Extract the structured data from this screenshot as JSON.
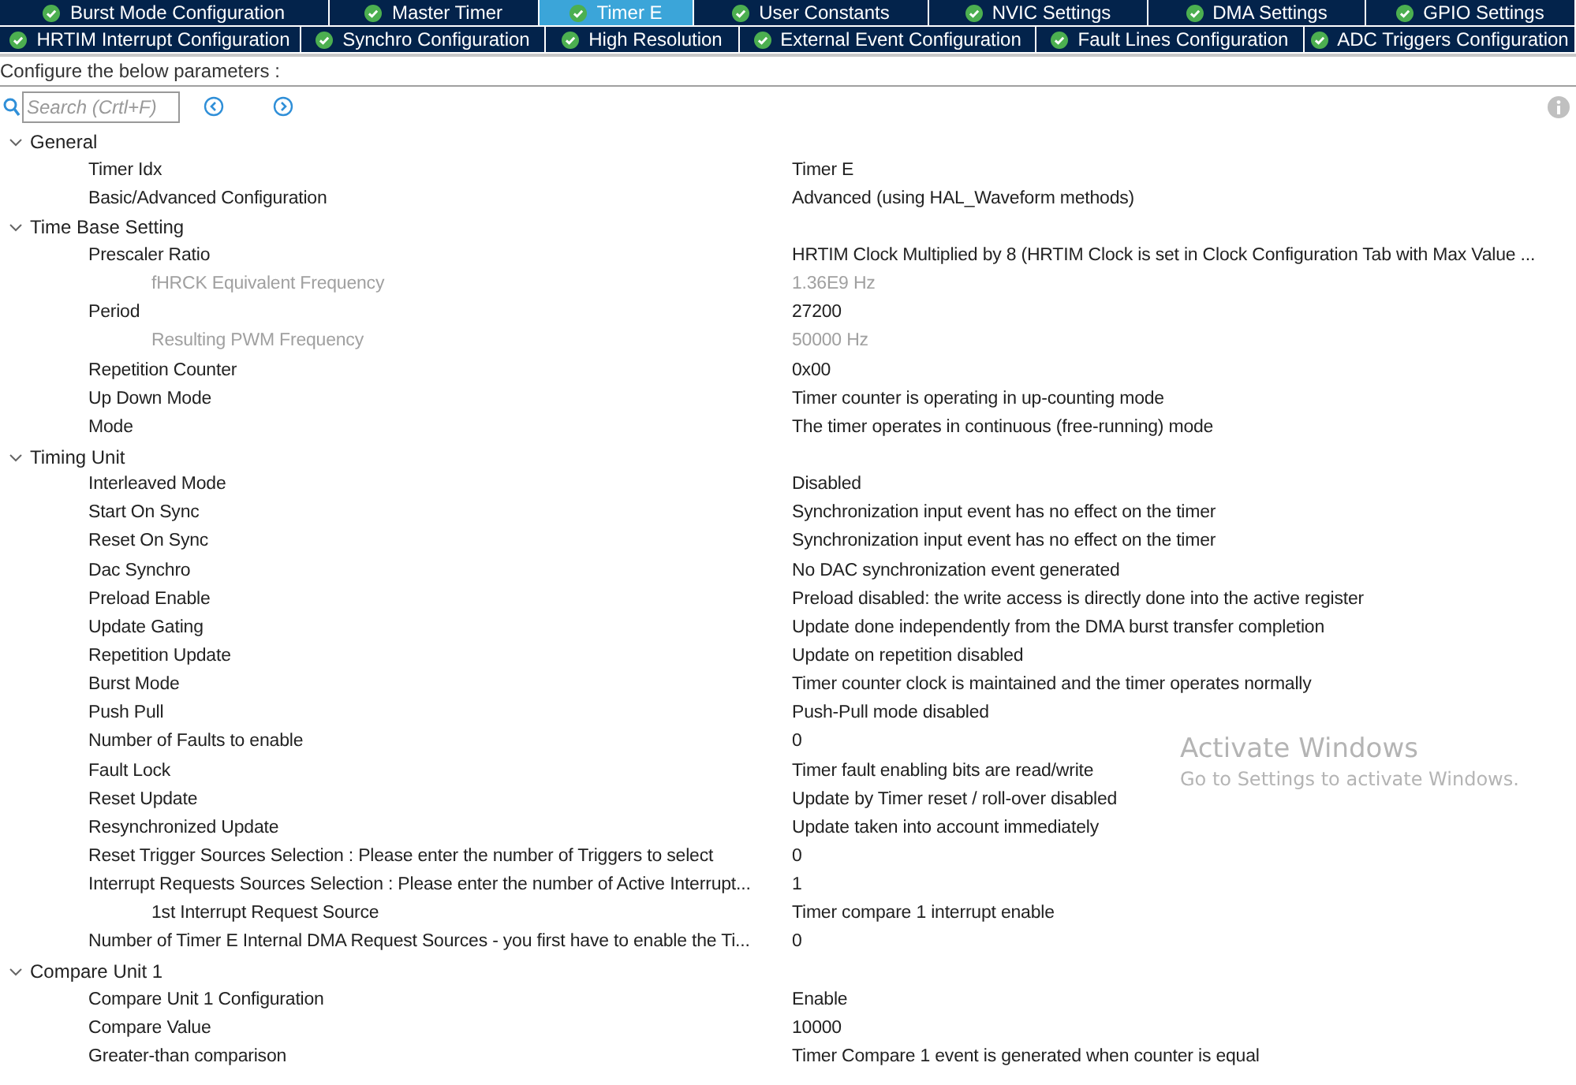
{
  "tab_rows": [
    [
      {
        "label": "Burst Mode Configuration",
        "selected": false
      },
      {
        "label": "Master Timer",
        "selected": false
      },
      {
        "label": "Timer E",
        "selected": true
      },
      {
        "label": "User Constants",
        "selected": false
      },
      {
        "label": "NVIC Settings",
        "selected": false
      },
      {
        "label": "DMA Settings",
        "selected": false
      },
      {
        "label": "GPIO Settings",
        "selected": false
      }
    ],
    [
      {
        "label": "HRTIM Interrupt Configuration",
        "selected": false
      },
      {
        "label": "Synchro Configuration",
        "selected": false
      },
      {
        "label": "High Resolution",
        "selected": false
      },
      {
        "label": "External Event Configuration",
        "selected": false
      },
      {
        "label": "Fault Lines Configuration",
        "selected": false
      },
      {
        "label": "ADC Triggers Configuration",
        "selected": false
      }
    ]
  ],
  "heading": "Configure the below parameters :",
  "search": {
    "placeholder": "Search (Crtl+F)"
  },
  "groups": [
    {
      "label": "General",
      "expanded": true,
      "params": [
        {
          "label": "Timer Idx",
          "value": "Timer E",
          "disabled": false
        },
        {
          "label": "Basic/Advanced Configuration",
          "value": "Advanced (using HAL_Waveform methods)",
          "disabled": false
        }
      ]
    },
    {
      "label": "Time Base Setting",
      "expanded": true,
      "params": [
        {
          "label": "Prescaler Ratio",
          "value": "HRTIM Clock Multiplied by 8 (HRTIM Clock is set in Clock Configuration Tab with Max Value ...",
          "disabled": false,
          "children": [
            {
              "label": "fHRCK Equivalent Frequency",
              "value": "1.36E9 Hz",
              "disabled": true
            }
          ]
        },
        {
          "label": "Period",
          "value": "27200",
          "disabled": false,
          "children": [
            {
              "label": "Resulting PWM Frequency",
              "value": "50000 Hz",
              "disabled": true
            }
          ]
        },
        {
          "label": "Repetition Counter",
          "value": "0x00",
          "disabled": false
        },
        {
          "label": "Up Down Mode",
          "value": "Timer counter is operating in up-counting mode",
          "disabled": false
        },
        {
          "label": "Mode",
          "value": "The timer operates in continuous (free-running) mode",
          "disabled": false
        }
      ]
    },
    {
      "label": "Timing Unit",
      "expanded": true,
      "params": [
        {
          "label": "Interleaved Mode",
          "value": "Disabled",
          "disabled": false
        },
        {
          "label": "Start On Sync",
          "value": "Synchronization input event has no effect on the timer",
          "disabled": false
        },
        {
          "label": "Reset On Sync",
          "value": "Synchronization input event has no effect on the timer",
          "disabled": false
        },
        {
          "label": "Dac Synchro",
          "value": "No DAC synchronization event generated",
          "disabled": false
        },
        {
          "label": "Preload Enable",
          "value": "Preload disabled: the write access is directly done into the active register",
          "disabled": false
        },
        {
          "label": "Update Gating",
          "value": "Update done independently from the DMA burst transfer completion",
          "disabled": false
        },
        {
          "label": "Repetition Update",
          "value": "Update on repetition disabled",
          "disabled": false
        },
        {
          "label": "Burst Mode",
          "value": "Timer counter clock is maintained and the timer operates normally",
          "disabled": false
        },
        {
          "label": "Push Pull",
          "value": "Push-Pull mode disabled",
          "disabled": false
        },
        {
          "label": "Number of Faults to enable",
          "value": "0",
          "disabled": false
        },
        {
          "label": "Fault Lock",
          "value": "Timer fault enabling bits are read/write",
          "disabled": false
        },
        {
          "label": "Reset Update",
          "value": "Update by Timer reset / roll-over disabled",
          "disabled": false
        },
        {
          "label": "Resynchronized Update",
          "value": "Update taken into account immediately",
          "disabled": false
        },
        {
          "label": "Reset Trigger Sources Selection : Please enter the number of Triggers to select",
          "value": "0",
          "disabled": false
        },
        {
          "label": "Interrupt Requests Sources Selection : Please enter the number of Active Interrupt...",
          "value": "1",
          "disabled": false,
          "children": [
            {
              "label": "1st Interrupt Request Source",
              "value": "Timer compare 1 interrupt enable",
              "disabled": false
            }
          ]
        },
        {
          "label": "Number of Timer E Internal DMA Request Sources  - you first have to enable the Ti...",
          "value": "0",
          "disabled": false
        }
      ]
    },
    {
      "label": "Compare Unit 1",
      "expanded": true,
      "params": [
        {
          "label": "Compare Unit 1 Configuration",
          "value": "Enable",
          "disabled": false
        },
        {
          "label": "Compare Value",
          "value": "10000",
          "disabled": false
        },
        {
          "label": "Greater-than comparison",
          "value": "Timer Compare 1 event is generated when counter is equal",
          "disabled": false
        }
      ]
    }
  ],
  "activation_notice": {
    "title": "Activate Windows",
    "text": "Go to Settings to activate Windows."
  }
}
